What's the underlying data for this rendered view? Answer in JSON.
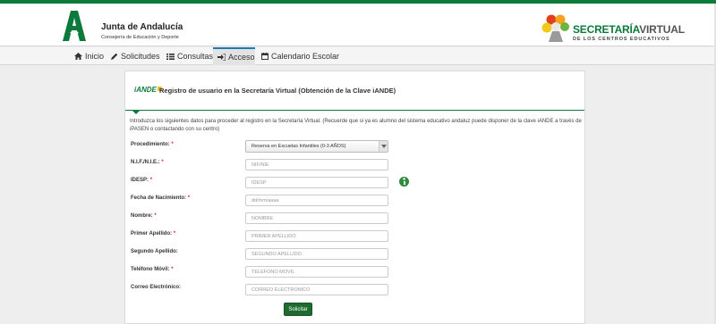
{
  "header": {
    "org_name": "Junta de Andalucía",
    "org_subtitle": "Consejería de Educación y Deporte",
    "brand_title_a": "SECRETARÍA",
    "brand_title_b": "VIRTUAL",
    "brand_subtitle": "DE LOS CENTROS EDUCATIVOS",
    "brand_color": "#0b7a3a"
  },
  "nav": {
    "items": [
      {
        "label": "Inicio",
        "icon": "home-icon"
      },
      {
        "label": "Solicitudes",
        "icon": "pencil-icon"
      },
      {
        "label": "Consultas",
        "icon": "list-icon"
      },
      {
        "label": "Acceso",
        "icon": "sign-in-icon",
        "active": true
      },
      {
        "label": "Calendario Escolar",
        "icon": "calendar-icon"
      }
    ]
  },
  "panel": {
    "logo_text": "iANDE",
    "title": "Registro de usuario en la Secretaría Virtual (Obtención de la Clave iANDE)",
    "intro": "Introduzca los siguientes datos para proceder al registro en la Secretaría Virtual. (Recuerde que si ya es alumno del sistema educativo andaluz puede disponer de la clave iANDE a través de iPASEN o contactando con su centro)"
  },
  "form": {
    "procedimiento": {
      "label": "Procedimiento:",
      "required": "*",
      "value": "Reserva en Escuelas Infantiles (0-3 AÑOS)"
    },
    "nif": {
      "label": "N.I.F./N.I.E.:",
      "required": "*",
      "placeholder": "NIF/NIE"
    },
    "idesp": {
      "label": "IDESP:",
      "required": "*",
      "placeholder": "IDESP"
    },
    "fecha": {
      "label": "Fecha de Nacimiento:",
      "required": "*",
      "placeholder": "dd/mm/aaaa"
    },
    "nombre": {
      "label": "Nombre:",
      "required": "*",
      "placeholder": "NOMBRE"
    },
    "apellido1": {
      "label": "Primer Apellido:",
      "required": "*",
      "placeholder": "PRIMER APELLIDO"
    },
    "apellido2": {
      "label": "Segundo Apellido:",
      "placeholder": "SEGUNDO APELLIDO"
    },
    "telefono": {
      "label": "Teléfono Móvil:",
      "required": "*",
      "placeholder": "TELÉFONO MÓVIL"
    },
    "email": {
      "label": "Correo Electrónico:",
      "placeholder": "CORREO ELECTRÓNICO"
    },
    "submit_label": "Solicitar"
  }
}
